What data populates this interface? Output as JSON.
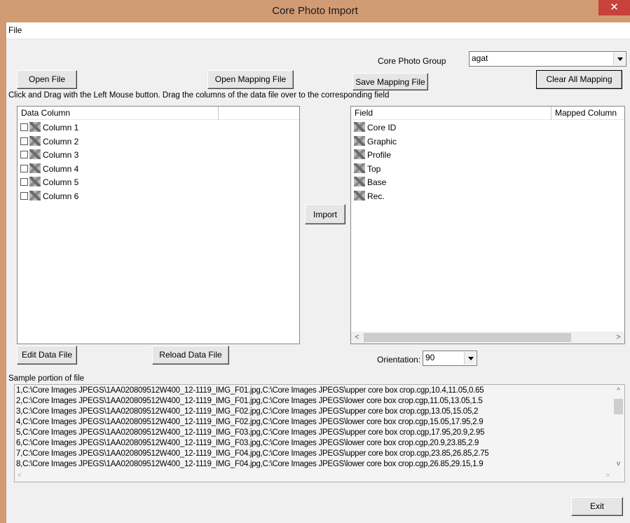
{
  "window": {
    "title": "Core Photo Import",
    "close_label": "✕"
  },
  "menu": {
    "file": "File"
  },
  "buttons": {
    "open_file": "Open File",
    "open_mapping": "Open Mapping File",
    "save_mapping": "Save Mapping File",
    "clear_mapping": "Clear All Mapping",
    "import": "Import",
    "edit_data": "Edit Data File",
    "reload_data": "Reload Data File",
    "exit": "Exit"
  },
  "core_photo_group": {
    "label": "Core Photo Group",
    "value": "agat"
  },
  "instructions": "Click and Drag with the Left Mouse button. Drag the columns of the data file over to the corresponding field",
  "data_columns": {
    "header": "Data Column",
    "items": [
      "Column 1",
      "Column 2",
      "Column 3",
      "Column 4",
      "Column 5",
      "Column 6"
    ]
  },
  "fields": {
    "header_field": "Field",
    "header_mapped": "Mapped Column",
    "items": [
      "Core ID",
      "Graphic",
      "Profile",
      "Top",
      "Base",
      "Rec."
    ]
  },
  "orientation": {
    "label": "Orientation:",
    "value": "90"
  },
  "sample": {
    "label": "Sample portion of file",
    "lines": [
      "1,C:\\Core Images JPEGS\\1AA020809512W400_12-1119_IMG_F01.jpg,C:\\Core Images JPEGS\\upper core box crop.cgp,10.4,11.05,0.65",
      "2,C:\\Core Images JPEGS\\1AA020809512W400_12-1119_IMG_F01.jpg,C:\\Core Images JPEGS\\lower core box crop.cgp,11.05,13.05,1.5",
      "3,C:\\Core Images JPEGS\\1AA020809512W400_12-1119_IMG_F02.jpg,C:\\Core Images JPEGS\\upper core box crop.cgp,13.05,15.05,2",
      "4,C:\\Core Images JPEGS\\1AA020809512W400_12-1119_IMG_F02.jpg,C:\\Core Images JPEGS\\lower core box crop.cgp,15.05,17.95,2.9",
      "5,C:\\Core Images JPEGS\\1AA020809512W400_12-1119_IMG_F03.jpg,C:\\Core Images JPEGS\\upper core box crop.cgp,17.95,20.9,2.95",
      "6,C:\\Core Images JPEGS\\1AA020809512W400_12-1119_IMG_F03.jpg,C:\\Core Images JPEGS\\lower core box crop.cgp,20.9,23.85,2.9",
      "7,C:\\Core Images JPEGS\\1AA020809512W400_12-1119_IMG_F04.jpg,C:\\Core Images JPEGS\\upper core box crop.cgp,23.85,26.85,2.75",
      "8,C:\\Core Images JPEGS\\1AA020809512W400_12-1119_IMG_F04.jpg,C:\\Core Images JPEGS\\lower core box crop.cgp,26.85,29.15,1.9"
    ]
  },
  "colors": {
    "frame": "#d19b74",
    "close": "#c8413a",
    "dialog": "#f0f0f0"
  }
}
